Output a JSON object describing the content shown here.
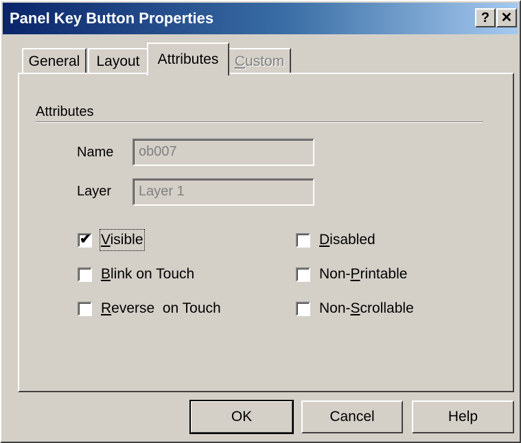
{
  "window": {
    "title": "Panel Key Button Properties",
    "help_button": "?",
    "close_button": "✕"
  },
  "tabs": [
    {
      "label": "General",
      "state": "normal"
    },
    {
      "label": "Layout",
      "state": "normal"
    },
    {
      "label": "Attributes",
      "state": "active"
    },
    {
      "label_prefix": "",
      "label_ul": "C",
      "label_rest": "ustom",
      "state": "disabled"
    }
  ],
  "attributes": {
    "group_label": "Attributes",
    "name_label": "Name",
    "name_value": "ob007",
    "layer_label": "Layer",
    "layer_value": "Layer 1"
  },
  "checkboxes": {
    "visible": {
      "pre": "",
      "ul": "V",
      "post": "isible",
      "checked": true
    },
    "blink": {
      "pre": "",
      "ul": "B",
      "post": "link on Touch",
      "checked": false
    },
    "reverse": {
      "pre": "",
      "ul": "R",
      "post": "everse  on Touch",
      "checked": false
    },
    "disabled": {
      "pre": "",
      "ul": "D",
      "post": "isabled",
      "checked": false
    },
    "non_printable": {
      "pre": "Non-",
      "ul": "P",
      "post": "rintable",
      "checked": false
    },
    "non_scrollable": {
      "pre": "Non-",
      "ul": "S",
      "post": "crollable",
      "checked": false
    },
    "check_glyph": "✔"
  },
  "buttons": {
    "ok": "OK",
    "cancel": "Cancel",
    "help": "Help"
  }
}
